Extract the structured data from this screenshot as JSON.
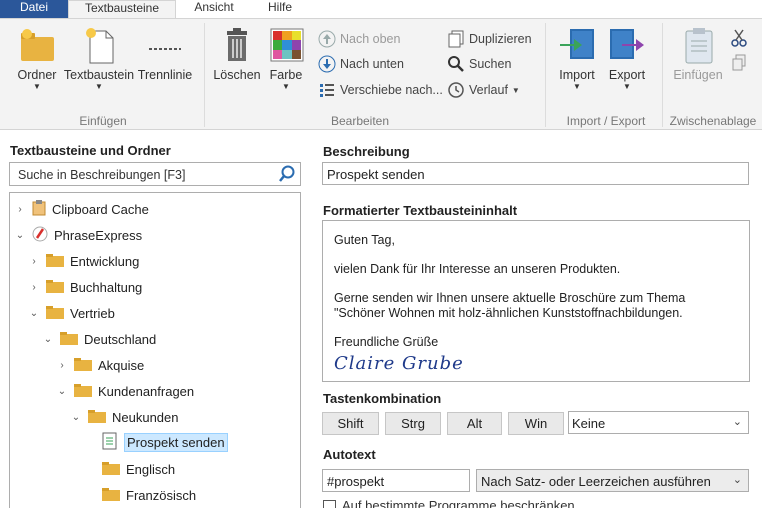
{
  "tabs": {
    "file": "Datei",
    "t2": "Textbausteine",
    "t3": "Ansicht",
    "t4": "Hilfe"
  },
  "ribbon": {
    "einfuegen": {
      "ordner": "Ordner",
      "textbaustein": "Textbaustein",
      "trennlinie": "Trennlinie",
      "title": "Einfügen"
    },
    "bearbeiten": {
      "loeschen": "Löschen",
      "farbe": "Farbe",
      "nach_oben": "Nach oben",
      "nach_unten": "Nach unten",
      "verschiebe": "Verschiebe nach...",
      "duplizieren": "Duplizieren",
      "suchen": "Suchen",
      "verlauf": "Verlauf",
      "title": "Bearbeiten"
    },
    "import_export": {
      "import": "Import",
      "export": "Export",
      "title": "Import / Export"
    },
    "zwischenablage": {
      "einfuegen": "Einfügen",
      "title": "Zwischenablage"
    }
  },
  "left": {
    "title": "Textbausteine und Ordner",
    "search_placeholder": "Suche in Beschreibungen [F3]",
    "tree": [
      {
        "label": "Clipboard Cache"
      },
      {
        "label": "PhraseExpress"
      },
      {
        "label": "Entwicklung"
      },
      {
        "label": "Buchhaltung"
      },
      {
        "label": "Vertrieb"
      },
      {
        "label": "Deutschland"
      },
      {
        "label": "Akquise"
      },
      {
        "label": "Kundenanfragen"
      },
      {
        "label": "Neukunden"
      },
      {
        "label": "Prospekt senden"
      },
      {
        "label": "Englisch"
      },
      {
        "label": "Französisch"
      }
    ]
  },
  "right": {
    "beschreibung_label": "Beschreibung",
    "beschreibung_value": "Prospekt senden",
    "inhalt_label": "Formatierter Textbausteininhalt",
    "inhalt_lines": [
      "Guten Tag,",
      "vielen Dank für Ihr Interesse an unseren Produkten.",
      "Gerne senden wir Ihnen unsere aktuelle Broschüre zum Thema",
      "\"Schöner Wohnen mit holz-ähnlichen Kunststoffnachbildungen.",
      "Freundliche Grüße",
      "Claire Grube"
    ],
    "tasten_label": "Tastenkombination",
    "keys": [
      "Shift",
      "Strg",
      "Alt",
      "Win"
    ],
    "key_select": "Keine",
    "autotext_label": "Autotext",
    "autotext_value": "#prospekt",
    "autotext_mode": "Nach Satz- oder Leerzeichen ausführen",
    "checkbox_label": "Auf bestimmte Programme beschränken"
  },
  "colors": {
    "file_tab": "#2b579a",
    "selection": "#cce8ff",
    "folder": "#e8b341"
  }
}
